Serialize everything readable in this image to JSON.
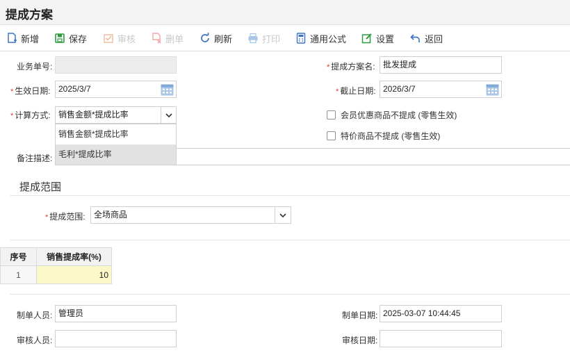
{
  "page": {
    "title": "提成方案"
  },
  "toolbar": {
    "new": "新增",
    "save": "保存",
    "audit": "审核",
    "delete": "删单",
    "refresh": "刷新",
    "print": "打印",
    "formula": "通用公式",
    "settings": "设置",
    "back": "返回"
  },
  "form": {
    "order_no_label": "业务单号:",
    "order_no_value": "",
    "scheme_name_label": "提成方案名:",
    "scheme_name_value": "批发提成",
    "effective_date_label": "生效日期:",
    "effective_date_value": "2025/3/7",
    "end_date_label": "截止日期:",
    "end_date_value": "2026/3/7",
    "calc_method_label": "计算方式:",
    "calc_method_value": "销售金额*提成比率",
    "calc_method_options": [
      "销售金额*提成比率",
      "毛利*提成比率"
    ],
    "member_discount_label": "会员优惠商品不提成 (零售生效)",
    "special_price_label": "特价商品不提成 (零售生效)",
    "remark_label": "备注描述:",
    "remark_value": ""
  },
  "range_section": {
    "title": "提成范围",
    "range_label": "提成范围:",
    "range_value": "全场商品"
  },
  "grid": {
    "headers": [
      "序号",
      "销售提成率(%)"
    ],
    "rows": [
      {
        "index": "1",
        "rate": "10"
      }
    ]
  },
  "footer": {
    "creator_label": "制单人员:",
    "creator_value": "管理员",
    "create_date_label": "制单日期:",
    "create_date_value": "2025-03-07 10:44:45",
    "auditor_label": "审核人员:",
    "auditor_value": "",
    "audit_date_label": "审核日期:",
    "audit_date_value": ""
  },
  "colors": {
    "required_mark": "#e0393e",
    "grid_highlight": "#fbf8c8",
    "icon_blue": "#3b73c9",
    "icon_green": "#2e9b3f"
  }
}
